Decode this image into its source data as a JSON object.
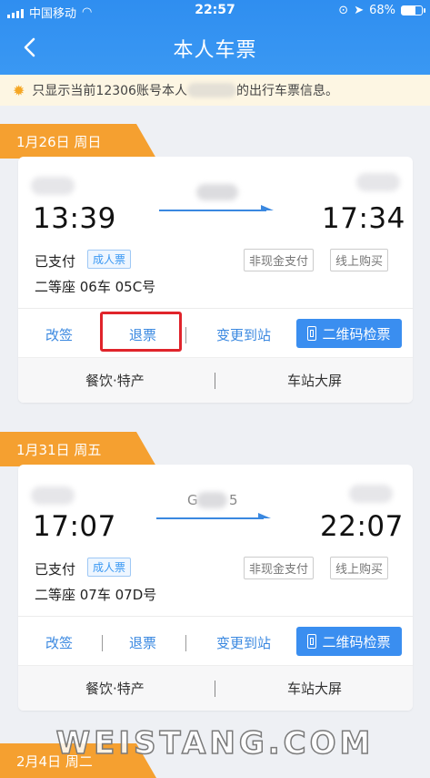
{
  "status_bar": {
    "carrier": "中国移动",
    "time": "22:57",
    "battery": "68%",
    "battery_level": 0.68
  },
  "nav": {
    "title": "本人车票"
  },
  "notice": {
    "text_before": "只显示当前12306账号本人",
    "text_after": "的出行车票信息。"
  },
  "tickets": [
    {
      "date": "1月26日 周日",
      "depart_time": "13:39",
      "arrive_time": "17:34",
      "train_no": "",
      "pay_status": "已支付",
      "ticket_type": "成人票",
      "tags": [
        "非现金支付",
        "线上购买"
      ],
      "seat": "二等座 06车 05C号",
      "actions": [
        "改签",
        "退票",
        "变更到站"
      ],
      "qr_label": "二维码检票",
      "footer": [
        "餐饮·特产",
        "车站大屏"
      ]
    },
    {
      "date": "1月31日 周五",
      "depart_time": "17:07",
      "arrive_time": "22:07",
      "train_no_left": "G",
      "train_no_right": "5",
      "pay_status": "已支付",
      "ticket_type": "成人票",
      "tags": [
        "非现金支付",
        "线上购买"
      ],
      "seat": "二等座 07车 07D号",
      "actions": [
        "改签",
        "退票",
        "变更到站"
      ],
      "qr_label": "二维码检票",
      "footer": [
        "餐饮·特产",
        "车站大屏"
      ]
    }
  ],
  "next_date": "2月4日 周二",
  "watermark": "WEISTANG.COM",
  "colors": {
    "header": "#3a98f3",
    "date_tab": "#f5a030",
    "accent": "#3a88e0",
    "highlight": "#e0242b"
  }
}
